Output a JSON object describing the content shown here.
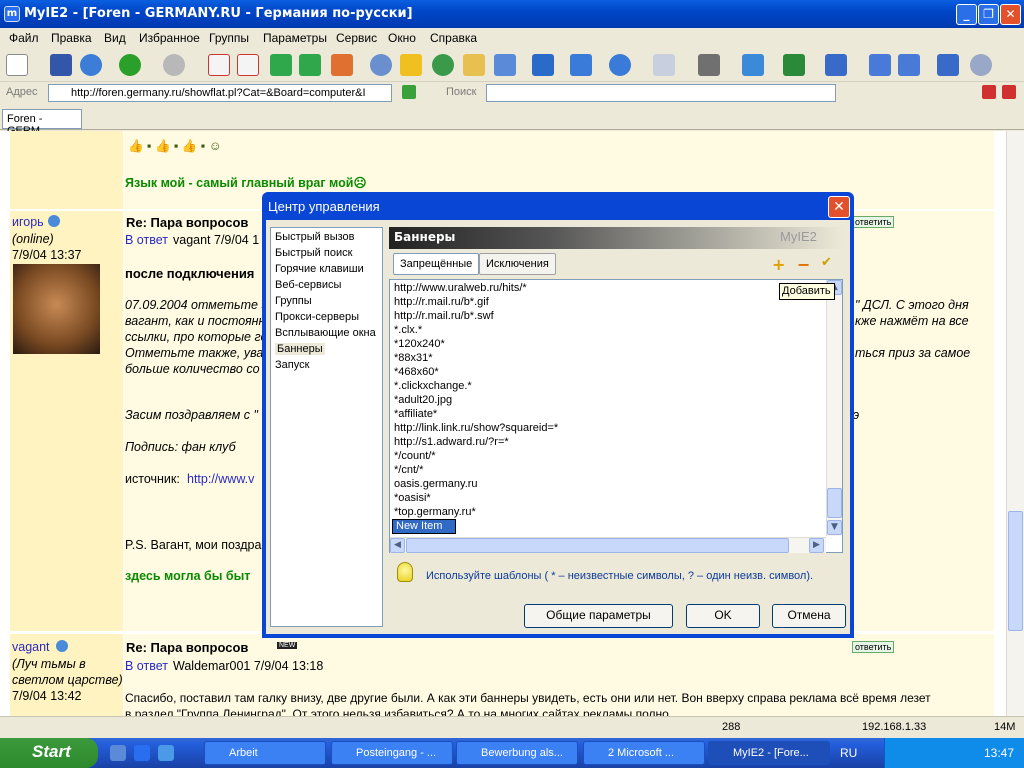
{
  "window": {
    "title": "MyIE2 - [Foren - GERMANY.RU - Германия по-русски]",
    "icon": "myie2-app-icon",
    "min": "_",
    "max": "❐",
    "close": "✕"
  },
  "menu": [
    "Файл",
    "Правка",
    "Вид",
    "Избранное",
    "Группы",
    "Параметры",
    "Сервис",
    "Окно",
    "Справка"
  ],
  "address": {
    "label": "Адрес",
    "url": "http://foren.germany.ru/showflat.pl?Cat=&Board=computer&I",
    "search_label": "Поиск"
  },
  "tab": {
    "label": "Foren - GERM..."
  },
  "page": {
    "smiles_row": "👍 ▪ 👍 ▪ 👍 ▪ ☺",
    "line1": "Язык мой - самый главный враг мой☹",
    "post1": {
      "user": "игорь",
      "status": "(online)",
      "date": "7/9/04 13:37",
      "subject": "Re: Пара вопросов",
      "reply_prefix": "В ответ",
      "reply_to": "vagant 7/9/04 1",
      "reply_btn": "ответить",
      "bold": "после подключения",
      "p1a": "07.09.2004 отметьте э",
      "p1b": "\" ДСЛ. С этого дня",
      "p2a": "вагант, как и постоянн",
      "p2b": "кже нажмёт на все",
      "p3a": "ссылки, про которые го",
      "p4a": "Отметьте также, уваж",
      "p4b": "ться приз за самое",
      "p5a": "больше количество со",
      "p6a": "Засим поздравляем с \"",
      "p6b": "э",
      "p7a": "Подпись: фан клуб",
      "p8a": "источник: ",
      "p8link": "http://www.v",
      "p9a": "P.S. Вагант, мои поздра",
      "p10a": "здесь могла бы быт"
    },
    "post2": {
      "user": "vagant",
      "status1": "(Луч тьмы в",
      "status2": "светлом царстве)",
      "date": "7/9/04 13:42",
      "subject": "Re: Пара вопросов",
      "new_badge": "NEW",
      "reply_prefix": "В ответ",
      "reply_to": "Waldemar001 7/9/04 13:18",
      "reply_btn": "ответить",
      "text1": "Спасибо, поставил там галку внизу, две другие были. А как эти баннеры увидеть, есть они или нет. Вон вверху справа реклама всё время лезет",
      "text2": "в раздел \"Группа Ленинград\". От этого нельзя избавиться? А то на многих сайтах рекламы полно"
    }
  },
  "status": {
    "count": "288",
    "ip": "192.168.1.33",
    "mem": "14M"
  },
  "taskbar": {
    "start": "Start",
    "tasks": [
      "Arbeit",
      "Posteingang - ...",
      "Bewerbung als...",
      "2 Microsoft ...",
      "MyIE2 - [Fore..."
    ],
    "lang": "RU",
    "clock": "13:47"
  },
  "dialog": {
    "title": "Центр управления",
    "close": "✕",
    "nav": [
      "Быстрый вызов",
      "Быстрый поиск",
      "Горячие клавиши",
      "Веб-сервисы",
      "Группы",
      "Прокси-серверы",
      "Всплывающие окна",
      "Баннеры",
      "Запуск"
    ],
    "selected_nav": "Баннеры",
    "panel_title": "Баннеры",
    "brand": "MyIE2",
    "tabs": [
      "Запрещённые",
      "Исключения"
    ],
    "add": "+",
    "remove": "−",
    "check": "✔",
    "tooltip": "Добавить",
    "items": [
      "http://www.uralweb.ru/hits/*",
      "http://r.mail.ru/b*.gif",
      "http://r.mail.ru/b*.swf",
      "*.clx.*",
      "*120x240*",
      "*88x31*",
      "*468x60*",
      "*.clickxchange.*",
      "*adult20.jpg",
      "*affiliate*",
      "http://link.link.ru/show?squareid=*",
      "http://s1.adward.ru/?r=*",
      "*/count/*",
      "*/cnt/*",
      "oasis.germany.ru",
      "*oasisi*",
      "*top.germany.ru*"
    ],
    "new_item": "New Item",
    "hint": "Используйте шаблоны ( * – неизвестные символы, ? – один неизв. символ).",
    "btn_general": "Общие параметры",
    "btn_ok": "OK",
    "btn_cancel": "Отмена"
  },
  "colors": {
    "xp_blue": "#0a46d6",
    "post_left": "#fff4c1",
    "post_right": "#fffbe3",
    "green_text": "#0a8a00",
    "link": "#2a2ac0"
  }
}
